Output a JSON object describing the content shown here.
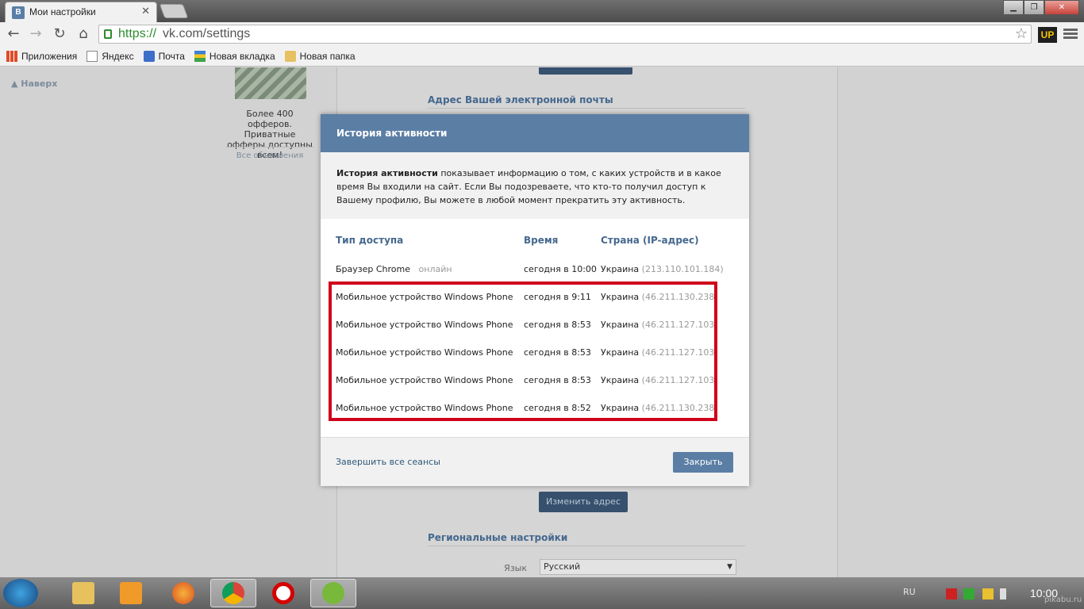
{
  "browser": {
    "tab_title": "Мои настройки",
    "tab_favicon": "В",
    "url_scheme": "https://",
    "url_rest": "vk.com/settings",
    "extension": "UP",
    "bookmarks": [
      "Приложения",
      "Яндекс",
      "Почта",
      "Новая вкладка",
      "Новая папка"
    ]
  },
  "page": {
    "back_to_top": "Наверх",
    "ad_text": "Более 400 офферов. Приватные офферы доступны всем!",
    "ad_all": "Все объявления",
    "email_heading": "Адрес Вашей электронной почты",
    "change_address": "Изменить адрес",
    "regional_heading": "Региональные настройки",
    "language_label": "Язык",
    "language_value": "Русский"
  },
  "modal": {
    "title": "История активности",
    "desc_bold": "История активности",
    "desc_rest": " показывает информацию о том, с каких устройств и в какое время Вы входили на сайт. Если Вы подозреваете, что кто-то получил доступ к Вашему профилю, Вы можете в любой момент прекратить эту активность.",
    "col_type": "Тип доступа",
    "col_time": "Время",
    "col_country": "Страна (IP-адрес)",
    "rows": [
      {
        "type": "Браузер Chrome",
        "status": "онлайн",
        "time": "сегодня в 10:00",
        "country": "Украина",
        "ip": "(213.110.101.184)"
      },
      {
        "type": "Мобильное устройство Windows Phone",
        "status": "",
        "time": "сегодня в 9:11",
        "country": "Украина",
        "ip": "(46.211.130.238)"
      },
      {
        "type": "Мобильное устройство Windows Phone",
        "status": "",
        "time": "сегодня в 8:53",
        "country": "Украина",
        "ip": "(46.211.127.103)"
      },
      {
        "type": "Мобильное устройство Windows Phone",
        "status": "",
        "time": "сегодня в 8:53",
        "country": "Украина",
        "ip": "(46.211.127.103)"
      },
      {
        "type": "Мобильное устройство Windows Phone",
        "status": "",
        "time": "сегодня в 8:53",
        "country": "Украина",
        "ip": "(46.211.127.103)"
      },
      {
        "type": "Мобильное устройство Windows Phone",
        "status": "",
        "time": "сегодня в 8:52",
        "country": "Украина",
        "ip": "(46.211.130.238)"
      }
    ],
    "end_all": "Завершить все сеансы",
    "close": "Закрыть"
  },
  "taskbar": {
    "language": "RU",
    "clock": "10:00",
    "apps": [
      "explorer-icon",
      "media-player-icon",
      "firefox-icon",
      "chrome-icon",
      "opera-icon",
      "utorrent-icon"
    ]
  },
  "watermark": "pikabu.ru",
  "colors": {
    "vk_blue": "#5b7ea5",
    "link": "#45688e",
    "highlight": "#d0021b"
  }
}
